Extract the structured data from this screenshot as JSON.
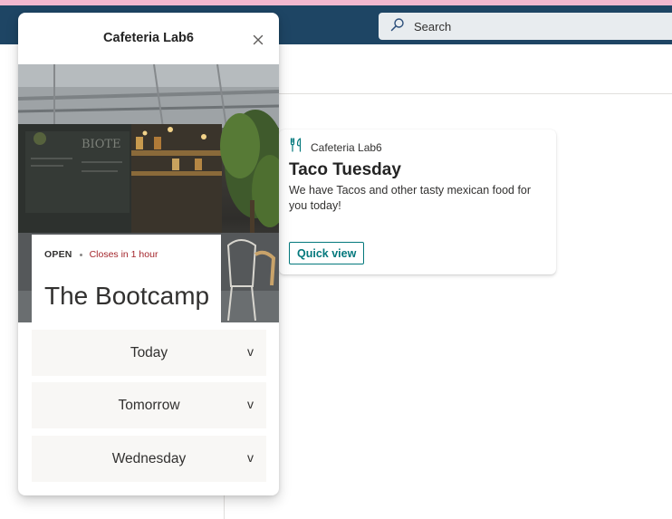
{
  "topbar": {
    "search_placeholder": "Search"
  },
  "colors": {
    "suite_bar": "#1e4564",
    "accent_teal": "#03787c",
    "closing_red": "#a4262c",
    "pink_strip": "#f2b8cf"
  },
  "card": {
    "icon": "fork-knife-icon",
    "app_name": "Cafeteria Lab6",
    "title": "Taco Tuesday",
    "description": "We have Tacos and other tasty mexican food for you today!",
    "button_label": "Quick view"
  },
  "quick_view": {
    "title": "Cafeteria Lab6",
    "close_icon": "close-icon",
    "status_open": "OPEN",
    "status_closing": "Closes in 1 hour",
    "location_name": "The Bootcamp",
    "days": [
      {
        "label": "Today",
        "chevron": "v"
      },
      {
        "label": "Tomorrow",
        "chevron": "v"
      },
      {
        "label": "Wednesday",
        "chevron": "v"
      }
    ]
  }
}
